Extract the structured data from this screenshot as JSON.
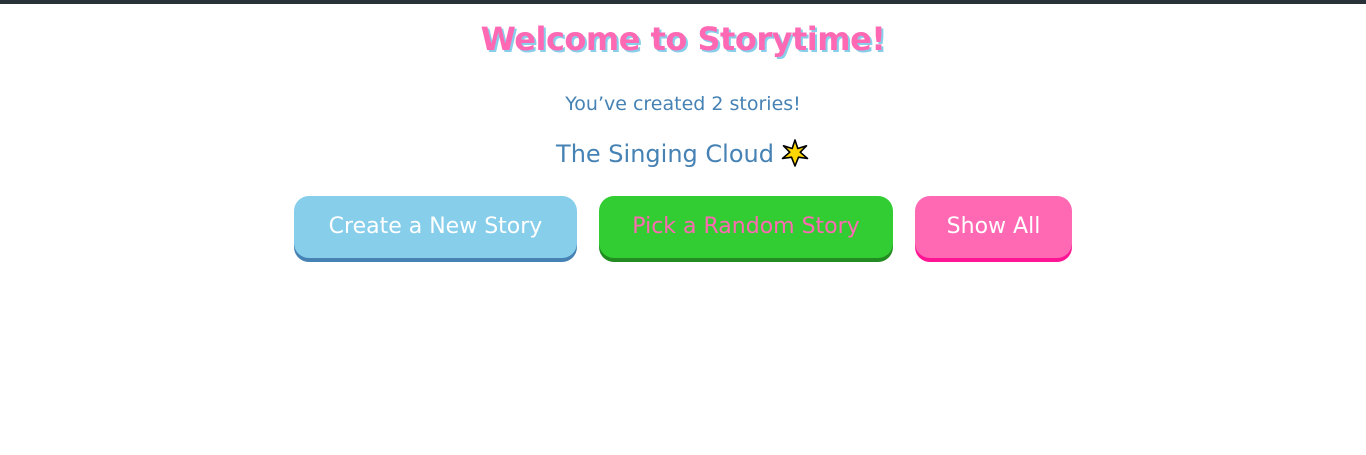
{
  "header": {
    "title": "Welcome to Storytime!"
  },
  "stats": {
    "stories_created_text": "You’ve created 2 stories!"
  },
  "current_story": {
    "title": "The Singing Cloud",
    "decoration_icon": "sparkle-star-icon"
  },
  "actions": {
    "create_label": "Create a New Story",
    "random_label": "Pick a Random Story",
    "show_all_label": "Show All"
  },
  "colors": {
    "top_strip": "#263238",
    "title_pink": "#ff69b4",
    "title_shadow_blue": "#87ceeb",
    "text_steel_blue": "#4682b4",
    "create_button": "#87ceeb",
    "random_button": "#32cd32",
    "show_all_button": "#ff69b4",
    "star_yellow": "#ffd700"
  }
}
